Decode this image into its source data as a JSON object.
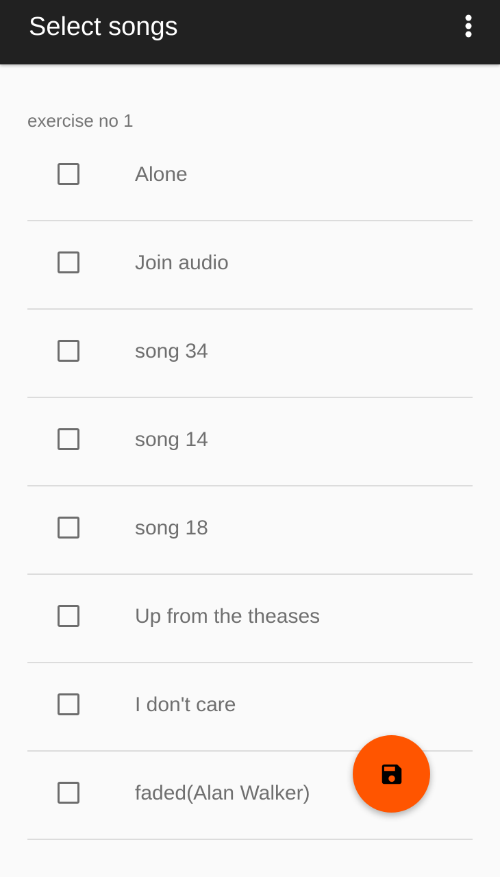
{
  "app_bar": {
    "title": "Select songs",
    "overflow_icon": "more-vert-icon",
    "background_color": "#212121"
  },
  "section": {
    "label": "exercise no 1"
  },
  "songs": [
    {
      "title": "Alone",
      "checked": false
    },
    {
      "title": "Join audio",
      "checked": false
    },
    {
      "title": "song 34",
      "checked": false
    },
    {
      "title": "song 14",
      "checked": false
    },
    {
      "title": "song 18",
      "checked": false
    },
    {
      "title": "Up from the theases",
      "checked": false
    },
    {
      "title": "I don't care",
      "checked": false
    },
    {
      "title": "faded(Alan Walker)",
      "checked": false
    }
  ],
  "fab": {
    "icon": "save-icon",
    "color": "#ff5500"
  }
}
